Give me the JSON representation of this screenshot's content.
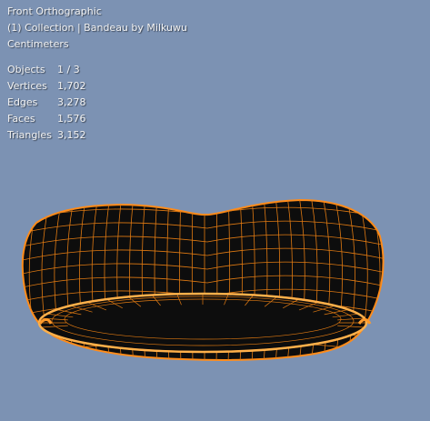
{
  "viewport": {
    "view_name": "Front Orthographic",
    "collection_line": "(1) Collection | Bandeau by Milkuwu",
    "units": "Centimeters",
    "background_color": "#7c92b3",
    "selection_color": "#ff8c1a"
  },
  "stats": [
    {
      "label": "Objects",
      "value": "1 / 3"
    },
    {
      "label": "Vertices",
      "value": "1,702"
    },
    {
      "label": "Edges",
      "value": "3,278"
    },
    {
      "label": "Faces",
      "value": "1,576"
    },
    {
      "label": "Triangles",
      "value": "3,152"
    }
  ]
}
